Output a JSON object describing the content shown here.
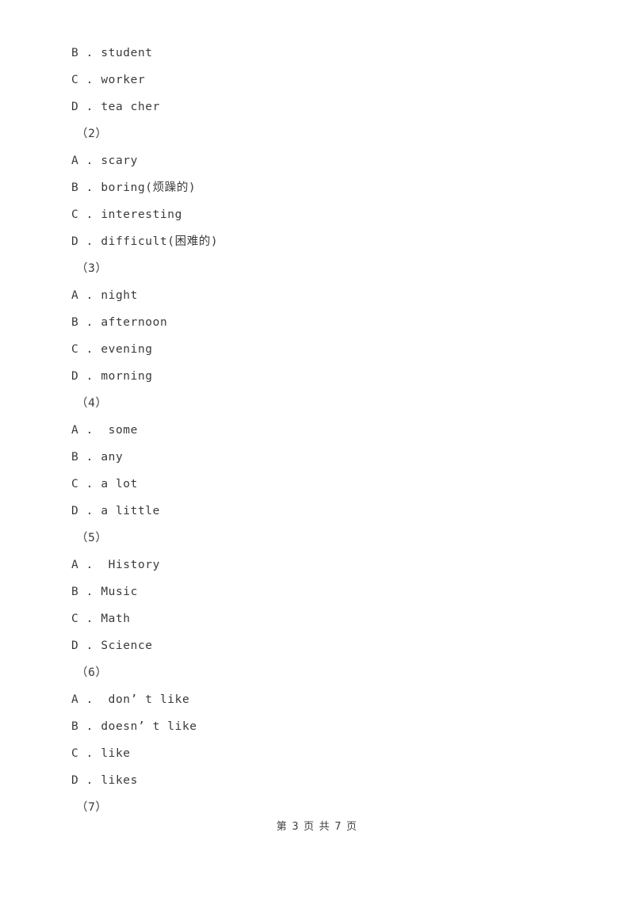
{
  "document": {
    "type": "exam-worksheet",
    "language": "en-with-zh-glosses",
    "text_color": "#3a3a3a",
    "background_color": "#ffffff"
  },
  "lines": [
    {
      "kind": "option",
      "text": "B . student"
    },
    {
      "kind": "option",
      "text": "C . worker"
    },
    {
      "kind": "option",
      "text": "D . tea cher"
    },
    {
      "kind": "group",
      "text": "（2）"
    },
    {
      "kind": "option",
      "text": "A . scary"
    },
    {
      "kind": "option",
      "text": "B . boring(烦躁的)"
    },
    {
      "kind": "option",
      "text": "C . interesting"
    },
    {
      "kind": "option",
      "text": "D . difficult(困难的)"
    },
    {
      "kind": "group",
      "text": "（3）"
    },
    {
      "kind": "option",
      "text": "A . night"
    },
    {
      "kind": "option",
      "text": "B . afternoon"
    },
    {
      "kind": "option",
      "text": "C . evening"
    },
    {
      "kind": "option",
      "text": "D . morning"
    },
    {
      "kind": "group",
      "text": "（4）"
    },
    {
      "kind": "option",
      "text": "A .  some"
    },
    {
      "kind": "option",
      "text": "B . any"
    },
    {
      "kind": "option",
      "text": "C . a lot"
    },
    {
      "kind": "option",
      "text": "D . a little"
    },
    {
      "kind": "group",
      "text": "（5）"
    },
    {
      "kind": "option",
      "text": "A .  History"
    },
    {
      "kind": "option",
      "text": "B . Music"
    },
    {
      "kind": "option",
      "text": "C . Math"
    },
    {
      "kind": "option",
      "text": "D . Science"
    },
    {
      "kind": "group",
      "text": "（6）"
    },
    {
      "kind": "option",
      "text": "A .  don’ t like"
    },
    {
      "kind": "option",
      "text": "B . doesn’ t like"
    },
    {
      "kind": "option",
      "text": "C . like"
    },
    {
      "kind": "option",
      "text": "D . likes"
    },
    {
      "kind": "group",
      "text": "（7）"
    }
  ],
  "footer": {
    "text": "第 3 页 共 7 页",
    "current_page": 3,
    "total_pages": 7
  }
}
